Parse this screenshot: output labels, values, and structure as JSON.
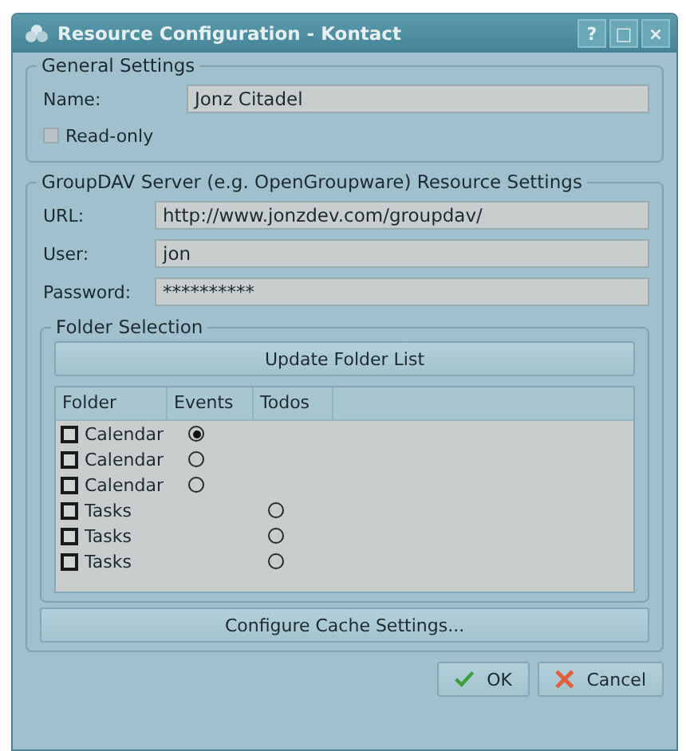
{
  "window": {
    "title": "Resource Configuration - Kontact",
    "buttons": [
      "?",
      "□",
      "×"
    ]
  },
  "general": {
    "title": "General Settings",
    "name_label": "Name:",
    "name_value": "Jonz Citadel",
    "readonly": {
      "label": "Read-only",
      "checked": false
    }
  },
  "server": {
    "title": "GroupDAV Server (e.g. OpenGroupware) Resource Settings",
    "fields": [
      {
        "label": "URL:",
        "value": "http://www.jonzdev.com/groupdav/"
      },
      {
        "label": "User:",
        "value": "jon"
      },
      {
        "label": "Password:",
        "value": "**********"
      }
    ],
    "folders": {
      "title": "Folder Selection",
      "update_button": "Update Folder List",
      "columns": [
        "Folder",
        "Events",
        "Todos"
      ],
      "rows": [
        {
          "name": "Calendar",
          "kind": "events",
          "checked": false,
          "selected": true
        },
        {
          "name": "Calendar",
          "kind": "events",
          "checked": false,
          "selected": false
        },
        {
          "name": "Calendar",
          "kind": "events",
          "checked": false,
          "selected": false
        },
        {
          "name": "Tasks",
          "kind": "todos",
          "checked": false,
          "selected": false
        },
        {
          "name": "Tasks",
          "kind": "todos",
          "checked": false,
          "selected": false
        },
        {
          "name": "Tasks",
          "kind": "todos",
          "checked": false,
          "selected": false
        }
      ]
    },
    "cache_button": "Configure Cache Settings..."
  },
  "buttons": [
    {
      "label": "OK",
      "kind": "ok"
    },
    {
      "label": "Cancel",
      "kind": "cancel"
    }
  ]
}
